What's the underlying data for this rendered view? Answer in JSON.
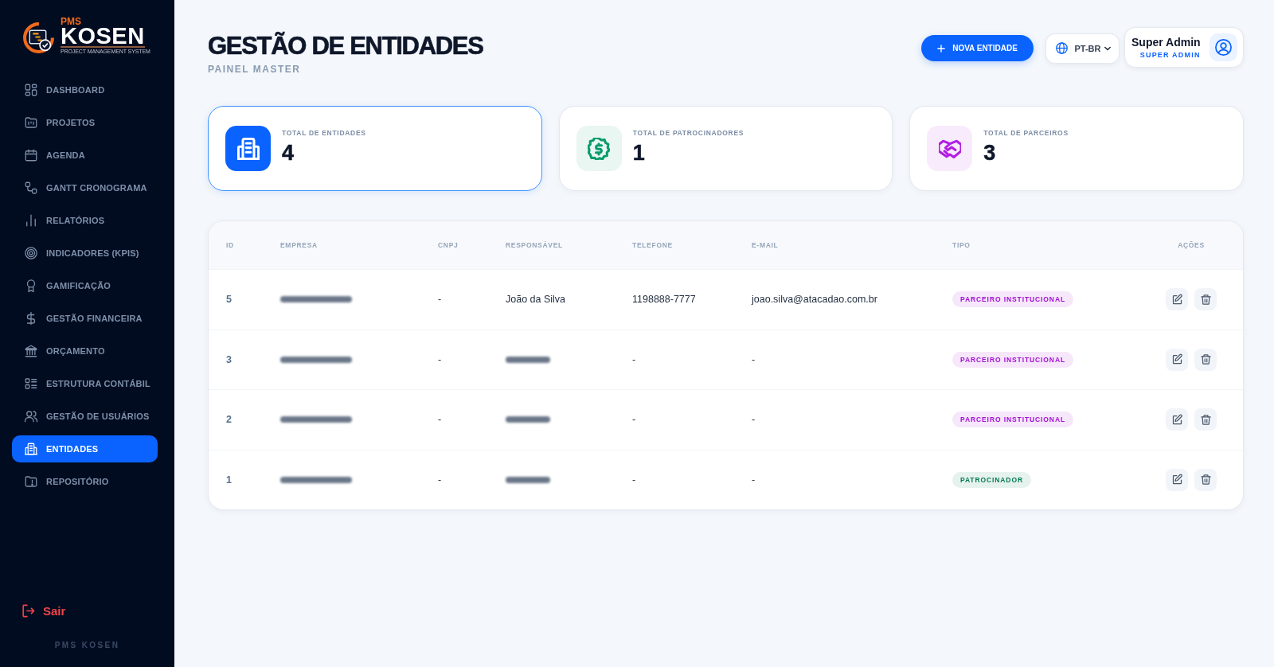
{
  "sidebar": {
    "logo": {
      "label": "PMS",
      "wordmark": "KOSEN",
      "tagline": "PROJECT MANAGEMENT SYSTEM"
    },
    "items": [
      {
        "label": "DASHBOARD",
        "selected": false
      },
      {
        "label": "PROJETOS",
        "selected": false
      },
      {
        "label": "AGENDA",
        "selected": false
      },
      {
        "label": "GANTT CRONOGRAMA",
        "selected": false
      },
      {
        "label": "RELATÓRIOS",
        "selected": false
      },
      {
        "label": "INDICADORES (KPIS)",
        "selected": false
      },
      {
        "label": "GAMIFICAÇÃO",
        "selected": false
      },
      {
        "label": "GESTÃO FINANCEIRA",
        "selected": false
      },
      {
        "label": "ORÇAMENTO",
        "selected": false
      },
      {
        "label": "ESTRUTURA CONTÁBIL",
        "selected": false
      },
      {
        "label": "GESTÃO DE USUÁRIOS",
        "selected": false
      },
      {
        "label": "ENTIDADES",
        "selected": true
      },
      {
        "label": "REPOSITÓRIO",
        "selected": false
      }
    ],
    "logout": "Sair",
    "footer": "PMS KOSEN"
  },
  "header": {
    "title": "GESTÃO DE ENTIDADES",
    "subtitle": "PAINEL MASTER",
    "new_button": "NOVA ENTIDADE",
    "language": "PT-BR",
    "user": {
      "name": "Super Admin",
      "role": "SUPER ADMIN"
    }
  },
  "stats": [
    {
      "label": "TOTAL DE ENTIDADES",
      "value": "4",
      "color": "#0a63ff",
      "selected": true
    },
    {
      "label": "TOTAL DE PATROCINADORES",
      "value": "1",
      "color": "#079b6b",
      "selected": false
    },
    {
      "label": "TOTAL DE PARCEIROS",
      "value": "3",
      "color": "#b21fe3",
      "selected": false
    }
  ],
  "table": {
    "columns": [
      "ID",
      "EMPRESA",
      "CNPJ",
      "RESPONSÁVEL",
      "TELEFONE",
      "E-MAIL",
      "TIPO",
      "AÇÕES"
    ],
    "rows": [
      {
        "id": "5",
        "empresa_blurred": true,
        "cnpj": "-",
        "responsavel": "João da Silva",
        "telefone": "1198888-7777",
        "email": "joao.silva@atacadao.com.br",
        "tipo": {
          "label": "PARCEIRO INSTITUCIONAL",
          "color": "#a20fd3"
        }
      },
      {
        "id": "3",
        "empresa_blurred": true,
        "cnpj": "-",
        "responsavel_blurred": true,
        "telefone": "-",
        "email": "-",
        "tipo": {
          "label": "PARCEIRO INSTITUCIONAL",
          "color": "#a20fd3"
        }
      },
      {
        "id": "2",
        "empresa_blurred": true,
        "cnpj": "-",
        "responsavel_blurred": true,
        "telefone": "-",
        "email": "-",
        "tipo": {
          "label": "PARCEIRO INSTITUCIONAL",
          "color": "#a20fd3"
        }
      },
      {
        "id": "1",
        "empresa_blurred": true,
        "cnpj": "-",
        "responsavel_blurred": true,
        "telefone": "-",
        "email": "-",
        "tipo": {
          "label": "PATROCINADOR",
          "color": "#057a52"
        }
      }
    ]
  }
}
